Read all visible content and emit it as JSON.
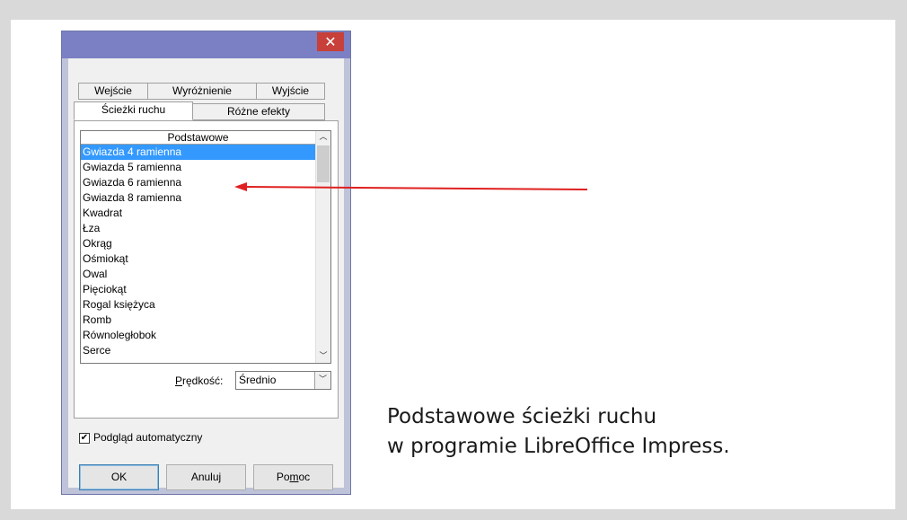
{
  "dialog": {
    "close_glyph": "✕",
    "tabs": {
      "row1": [
        "Wejście",
        "Wyróżnienie",
        "Wyjście"
      ],
      "row2": [
        "Ścieżki ruchu",
        "Różne efekty"
      ]
    },
    "list": {
      "header": "Podstawowe",
      "items": [
        "Gwiazda 4 ramienna",
        "Gwiazda 5 ramienna",
        "Gwiazda 6 ramienna",
        "Gwiazda 8 ramienna",
        "Kwadrat",
        "Łza",
        "Okrąg",
        "Ośmiokąt",
        "Owal",
        "Pięciokąt",
        "Rogal księżyca",
        "Romb",
        "Równoległobok",
        "Serce"
      ],
      "selected_index": 0
    },
    "speed": {
      "label_pre": "",
      "label_ul": "P",
      "label_post": "rędkość:",
      "value": "Średnio"
    },
    "auto_preview": {
      "label": "Podgląd automatyczny",
      "checked": true
    },
    "buttons": {
      "ok": "OK",
      "cancel": "Anuluj",
      "help_pre": "Po",
      "help_ul": "m",
      "help_post": "oc"
    }
  },
  "caption": {
    "line1": "Podstawowe ścieżki ruchu",
    "line2": "w programie LibreOffice Impress."
  },
  "colors": {
    "arrow": "#e02020",
    "selection": "#3399ff",
    "titlebar": "#7b7fc3",
    "close_button": "#c7403a"
  }
}
